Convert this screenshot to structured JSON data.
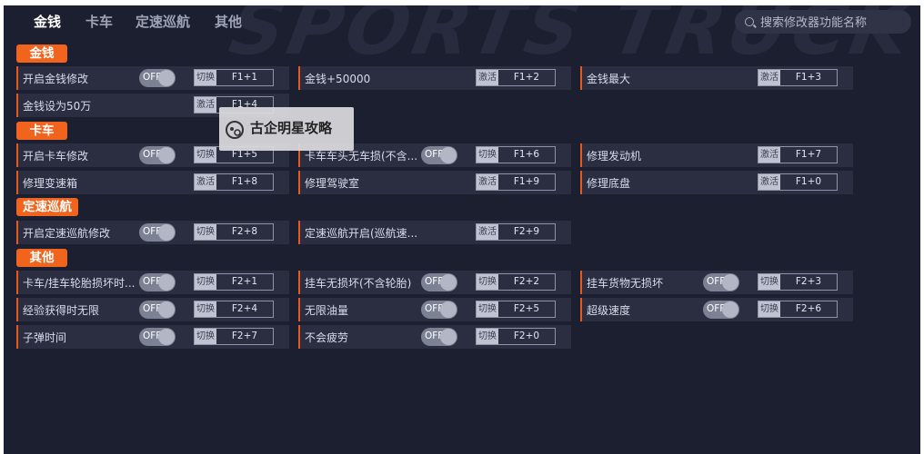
{
  "nav": {
    "tabs": [
      {
        "label": "金钱",
        "active": true
      },
      {
        "label": "卡车",
        "active": false
      },
      {
        "label": "定速巡航",
        "active": false
      },
      {
        "label": "其他",
        "active": false
      }
    ],
    "search_placeholder": "搜索修改器功能名称",
    "search_icon": "search-icon"
  },
  "background_watermark": "SPORTS TRUCK",
  "overlay_watermark": {
    "text": "古企明星攻略",
    "icon": "logo-icon"
  },
  "toggle_text": "OFF",
  "sections": [
    {
      "title": "金钱"
    },
    {
      "title": "卡车"
    },
    {
      "title": "定速巡航"
    },
    {
      "title": "其他"
    }
  ],
  "cheats": [
    {
      "label": "开启金钱修改",
      "toggle": true,
      "mode": "切换",
      "key": "F1+1"
    },
    {
      "label": "金钱+50000",
      "toggle": false,
      "mode": "激活",
      "key": "F1+2"
    },
    {
      "label": "金钱最大",
      "toggle": false,
      "mode": "激活",
      "key": "F1+3"
    },
    {
      "label": "金钱设为50万",
      "toggle": false,
      "mode": "激活",
      "key": "F1+4"
    },
    {
      "label": "开启卡车修改",
      "toggle": true,
      "mode": "切换",
      "key": "F1+5"
    },
    {
      "label": "卡车车头无车损(不含...",
      "toggle": true,
      "mode": "切换",
      "key": "F1+6"
    },
    {
      "label": "修理发动机",
      "toggle": false,
      "mode": "激活",
      "key": "F1+7"
    },
    {
      "label": "修理变速箱",
      "toggle": false,
      "mode": "激活",
      "key": "F1+8"
    },
    {
      "label": "修理驾驶室",
      "toggle": false,
      "mode": "激活",
      "key": "F1+9"
    },
    {
      "label": "修理底盘",
      "toggle": false,
      "mode": "激活",
      "key": "F1+0"
    },
    {
      "label": "开启定速巡航修改",
      "toggle": true,
      "mode": "切换",
      "key": "F2+8"
    },
    {
      "label": "定速巡航开启(巡航速...",
      "toggle": false,
      "mode": "激活",
      "key": "F2+9"
    },
    {
      "label": "卡车/挂车轮胎损坏时...",
      "toggle": true,
      "mode": "切换",
      "key": "F2+1"
    },
    {
      "label": "挂车无损坏(不含轮胎)",
      "toggle": true,
      "mode": "切换",
      "key": "F2+2"
    },
    {
      "label": "挂车货物无损坏",
      "toggle": true,
      "mode": "切换",
      "key": "F2+3"
    },
    {
      "label": "经验获得时无限",
      "toggle": true,
      "mode": "切换",
      "key": "F2+4"
    },
    {
      "label": "无限油量",
      "toggle": true,
      "mode": "切换",
      "key": "F2+5"
    },
    {
      "label": "超级速度",
      "toggle": true,
      "mode": "切换",
      "key": "F2+6"
    },
    {
      "label": "子弹时间",
      "toggle": true,
      "mode": "切换",
      "key": "F2+7"
    },
    {
      "label": "不会疲劳",
      "toggle": true,
      "mode": "切换",
      "key": "F2+0"
    }
  ],
  "colors": {
    "accent": "#f0641d",
    "background": "#1c1f2f",
    "cell": "#2a2e40"
  }
}
